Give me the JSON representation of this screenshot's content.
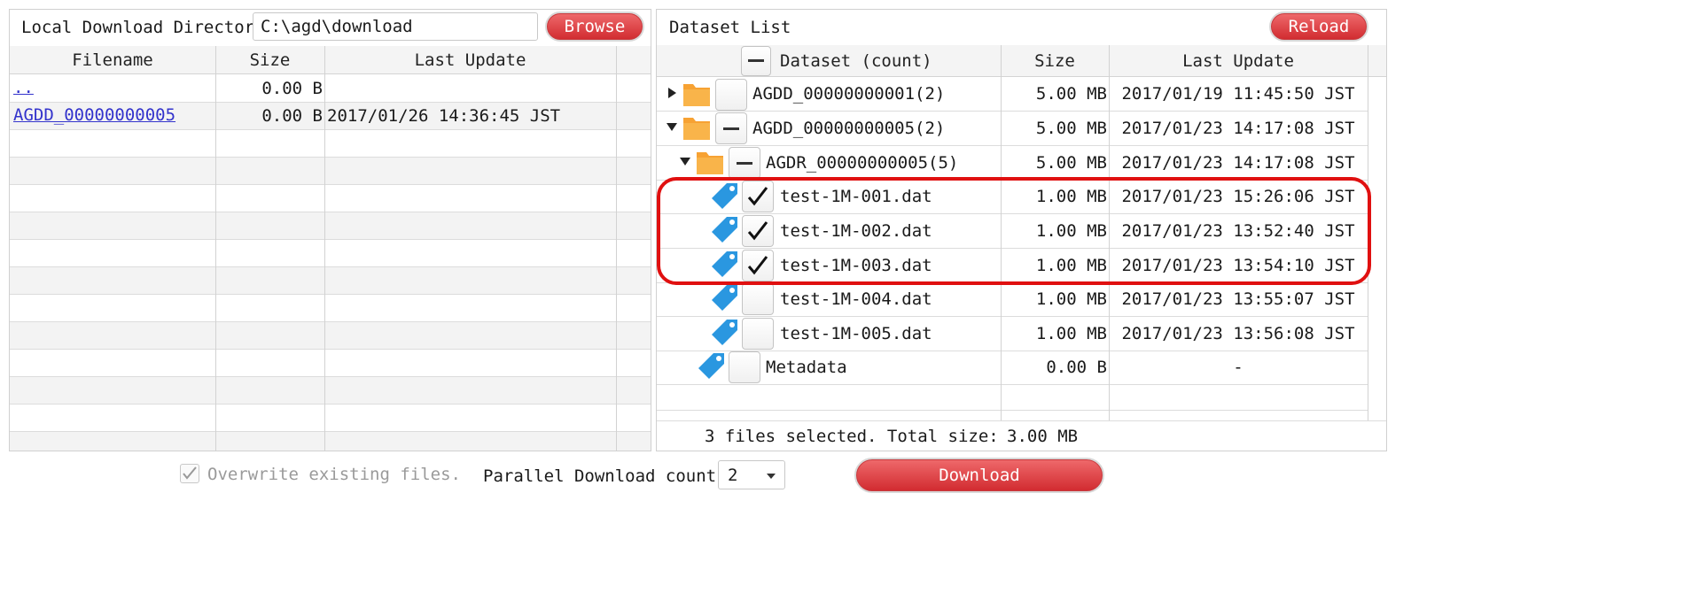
{
  "left": {
    "dir_label": "Local Download Directory",
    "dir_value": "C:\\agd\\download",
    "browse_label": "Browse",
    "columns": [
      "Filename",
      "Size",
      "Last Update"
    ],
    "rows": [
      {
        "name": "..",
        "size": "0.00 B",
        "updated": ""
      },
      {
        "name": "AGDD_00000000005",
        "size": "0.00 B",
        "updated": "2017/01/26 14:36:45 JST"
      }
    ]
  },
  "right": {
    "title": "Dataset List",
    "reload_label": "Reload",
    "columns": [
      "Dataset (count)",
      "Size",
      "Last Update"
    ],
    "rows": [
      {
        "name": "AGDD_00000000001(2)",
        "size": "5.00 MB",
        "updated": "2017/01/19 11:45:50 JST"
      },
      {
        "name": "AGDD_00000000005(2)",
        "size": "5.00 MB",
        "updated": "2017/01/23 14:17:08 JST"
      },
      {
        "name": "AGDR_00000000005(5)",
        "size": "5.00 MB",
        "updated": "2017/01/23 14:17:08 JST"
      },
      {
        "name": "test-1M-001.dat",
        "size": "1.00 MB",
        "updated": "2017/01/23 15:26:06 JST"
      },
      {
        "name": "test-1M-002.dat",
        "size": "1.00 MB",
        "updated": "2017/01/23 13:52:40 JST"
      },
      {
        "name": "test-1M-003.dat",
        "size": "1.00 MB",
        "updated": "2017/01/23 13:54:10 JST"
      },
      {
        "name": "test-1M-004.dat",
        "size": "1.00 MB",
        "updated": "2017/01/23 13:55:07 JST"
      },
      {
        "name": "test-1M-005.dat",
        "size": "1.00 MB",
        "updated": "2017/01/23 13:56:08 JST"
      },
      {
        "name": "Metadata",
        "size": "0.00 B",
        "updated": "-"
      }
    ],
    "selection_summary": "3 files selected. Total size:",
    "selection_total": "3.00 MB"
  },
  "bottom": {
    "overwrite_label": "Overwrite existing files.",
    "parallel_label": "Parallel Download count.",
    "parallel_value": "2",
    "download_label": "Download"
  },
  "icons": [
    "folder-icon",
    "tag-icon",
    "checkmark-icon",
    "minus-icon",
    "caret-icon",
    "dropdown-arrow-icon"
  ],
  "colors": {
    "accent_red": "#d12a2f",
    "folder_orange": "#f7a233",
    "tag_blue": "#2a97e0",
    "highlight_red": "#e01010",
    "link_blue": "#3333cc"
  }
}
